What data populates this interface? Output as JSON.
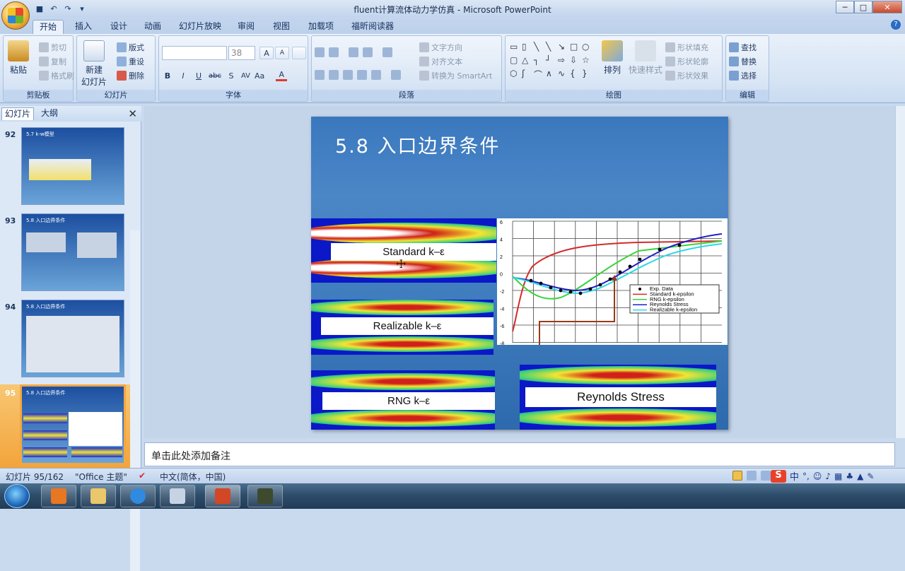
{
  "window": {
    "title": "fluent计算流体动力学仿真 - Microsoft PowerPoint",
    "minimize": "─",
    "maximize": "□",
    "close": "✕"
  },
  "qat": {
    "save": "■",
    "undo": "↶",
    "redo": "↷",
    "more": "▾"
  },
  "tabs": [
    "开始",
    "插入",
    "设计",
    "动画",
    "幻灯片放映",
    "审阅",
    "视图",
    "加载项",
    "福昕阅读器"
  ],
  "help": "?",
  "ribbon": {
    "clipboard": {
      "paste": "粘贴",
      "cut": "剪切",
      "copy": "复制",
      "format_painter": "格式刷",
      "label": "剪贴板"
    },
    "slides": {
      "new_slide": "新建",
      "new_slide2": "幻灯片",
      "layout": "版式",
      "reset": "重设",
      "delete": "删除",
      "label": "幻灯片"
    },
    "font": {
      "size": "38",
      "bold": "B",
      "italic": "I",
      "underline": "U",
      "strike": "abc",
      "shadow": "S",
      "spacing": "AV",
      "case": "Aa",
      "color": "A",
      "grow": "A",
      "shrink": "A",
      "label": "字体"
    },
    "paragraph": {
      "text_direction": "文字方向",
      "align_text": "对齐文本",
      "smartart": "转换为 SmartArt",
      "label": "段落"
    },
    "drawing": {
      "arrange": "排列",
      "quick_styles": "快速样式",
      "fill": "形状填充",
      "outline": "形状轮廓",
      "effects": "形状效果",
      "label": "绘图"
    },
    "editing": {
      "find": "查找",
      "replace": "替换",
      "select": "选择",
      "label": "编辑"
    }
  },
  "pane": {
    "tab_slides": "幻灯片",
    "tab_outline": "大纲",
    "close": "✕"
  },
  "thumbs": [
    {
      "num": "92",
      "title": "5.7 k-w模型"
    },
    {
      "num": "93",
      "title": "5.8 入口边界条件"
    },
    {
      "num": "94",
      "title": "5.8 入口边界条件"
    },
    {
      "num": "95",
      "title": "5.8 入口边界条件"
    }
  ],
  "slide": {
    "title": "5.8 入口边界条件",
    "panels": {
      "p1": "Standard k–ε",
      "p2": "Realizable k–ε",
      "p3": "RNG k–ε",
      "p4": "Reynolds Stress"
    }
  },
  "chart": {
    "yticks": [
      "6",
      "4",
      "2",
      "0",
      "-2",
      "-4",
      "-6",
      "-8"
    ],
    "legend": [
      "Exp. Data",
      "Standard k-epsilon",
      "RNG k-epsilon",
      "Reynolds Stress",
      "Realizable k-epsilon"
    ],
    "colors": {
      "exp": "#000000",
      "standard": "#d42a2a",
      "rng": "#3ad43a",
      "reynolds": "#2020c8",
      "realizable": "#2ad8e8"
    }
  },
  "notes": "单击此处添加备注",
  "status": {
    "slide": "幻灯片 95/162",
    "theme": "\"Office 主题\"",
    "lang": "中文(简体，中国)"
  },
  "ime": {
    "s": "S",
    "zh": "中",
    "punct": "°,"
  }
}
